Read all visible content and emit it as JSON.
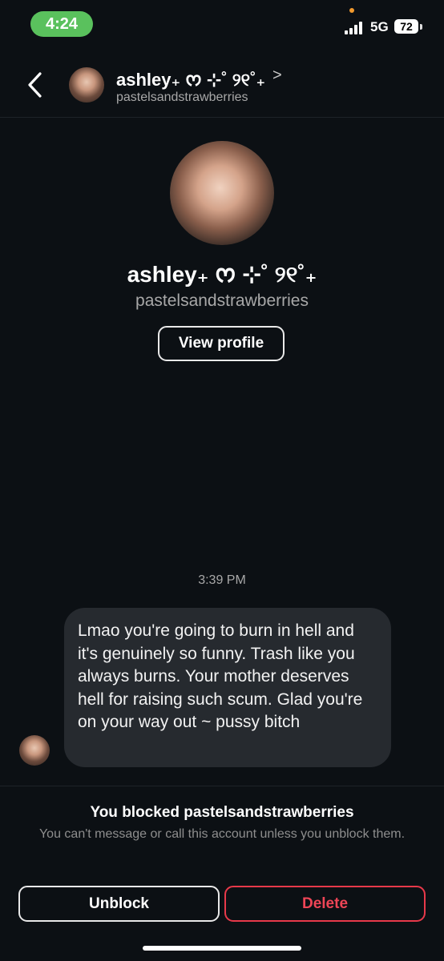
{
  "status_bar": {
    "time": "4:24",
    "network": "5G",
    "battery": "72"
  },
  "header": {
    "display_name": "ashley₊ ᰔ ⊹˚ ୨୧˚₊",
    "chevron": ">",
    "username": "pastelsandstrawberries"
  },
  "profile": {
    "display_name": "ashley₊ ᰔ ⊹˚ ୨୧˚₊",
    "username": "pastelsandstrawberries",
    "view_profile_label": "View profile"
  },
  "chat": {
    "timestamp": "3:39 PM",
    "message": "Lmao you're going to burn in hell and it's genuinely so funny. Trash like you always burns. Your mother deserves hell for raising such scum. Glad you're on your way out ~ pussy bitch"
  },
  "blocked": {
    "title": "You blocked pastelsandstrawberries",
    "description": "You can't message or call this account unless you unblock them."
  },
  "actions": {
    "unblock_label": "Unblock",
    "delete_label": "Delete"
  },
  "colors": {
    "background": "#0c1014",
    "bubble": "#262a2f",
    "time_pill": "#5ac15d",
    "delete_red": "#ee4556"
  }
}
